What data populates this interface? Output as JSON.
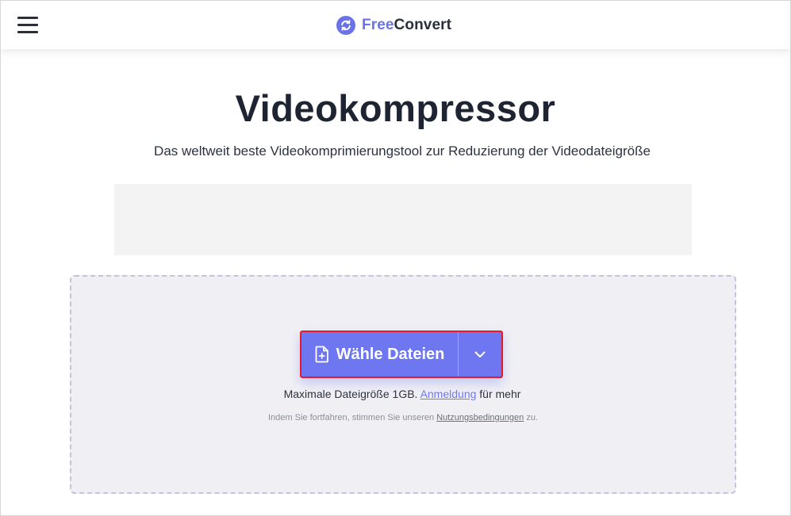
{
  "header": {
    "brand_free": "Free",
    "brand_convert": "Convert"
  },
  "main": {
    "title": "Videokompressor",
    "subtitle": "Das weltweit beste Videokomprimierungstool zur Reduzierung der Videodateigröße"
  },
  "upload": {
    "button_label": "Wähle Dateien",
    "max_size_prefix": "Maximale Dateigröße 1GB.",
    "login_link": "Anmeldung",
    "max_size_suffix": "für mehr",
    "terms_prefix": "Indem Sie fortfahren, stimmen Sie unseren",
    "terms_link": "Nutzungsbedingungen",
    "terms_suffix": "zu."
  },
  "colors": {
    "accent": "#6e77ef",
    "highlight_border": "#e8182c",
    "dropzone_bg": "#f0f0f4"
  },
  "icons": {
    "menu": "hamburger-menu-icon",
    "logo": "freeconvert-logo-icon",
    "file": "file-plus-icon",
    "dropdown": "chevron-down-icon"
  }
}
